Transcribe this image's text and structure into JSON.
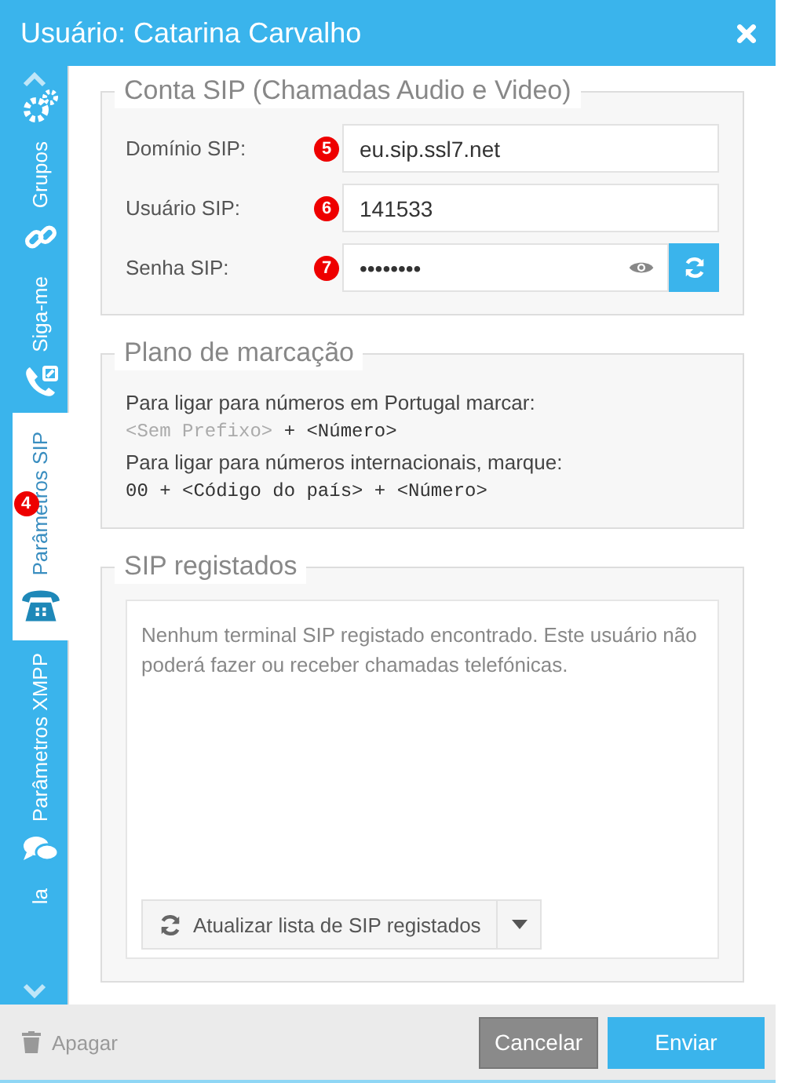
{
  "window": {
    "title": "Usuário: Catarina Carvalho"
  },
  "sidebar": {
    "items": [
      {
        "kind": "gear",
        "selected": false
      },
      {
        "kind": "link",
        "label": "Grupos",
        "selected": false
      },
      {
        "kind": "forward",
        "label": "Siga-me",
        "selected": false
      },
      {
        "kind": "phone",
        "label": "Parâmetros SIP",
        "selected": true,
        "badge": "4"
      },
      {
        "kind": "chat",
        "label": "Parâmetros XMPP",
        "selected": false
      },
      {
        "kind": "none",
        "label": "la",
        "selected": false
      }
    ]
  },
  "sip_account": {
    "title": "Conta SIP (Chamadas Audio e Video)",
    "fields": [
      {
        "kind": "text",
        "label": "Domínio SIP:",
        "badge": "5",
        "value": "eu.sip.ssl7.net"
      },
      {
        "kind": "text",
        "label": "Usuário SIP:",
        "badge": "6",
        "value": "141533"
      },
      {
        "kind": "password",
        "label": "Senha SIP:",
        "badge": "7",
        "value": "••••••••"
      }
    ]
  },
  "dial_plan": {
    "title": "Plano de marcação",
    "lines": [
      {
        "kind": "plain",
        "segments": [
          {
            "text": "Para ligar para números em Portugal marcar:",
            "muted": false
          }
        ]
      },
      {
        "kind": "code",
        "segments": [
          {
            "text": "<Sem Prefixo>",
            "muted": true
          },
          {
            "text": " + <Número>",
            "muted": false
          }
        ]
      },
      {
        "kind": "plain",
        "segments": [
          {
            "text": "Para ligar para números internacionais, marque:",
            "muted": false
          }
        ]
      },
      {
        "kind": "code",
        "segments": [
          {
            "text": "00 + <Código do país> + <Número>",
            "muted": false
          }
        ]
      }
    ]
  },
  "registered": {
    "title": "SIP registados",
    "message": "Nenhum terminal SIP registado encontrado. Este usuário não poderá fazer ou receber chamadas telefónicas.",
    "refresh_button": "Atualizar lista de SIP registados"
  },
  "footer": {
    "delete": "Apagar",
    "cancel": "Cancelar",
    "submit": "Enviar"
  }
}
